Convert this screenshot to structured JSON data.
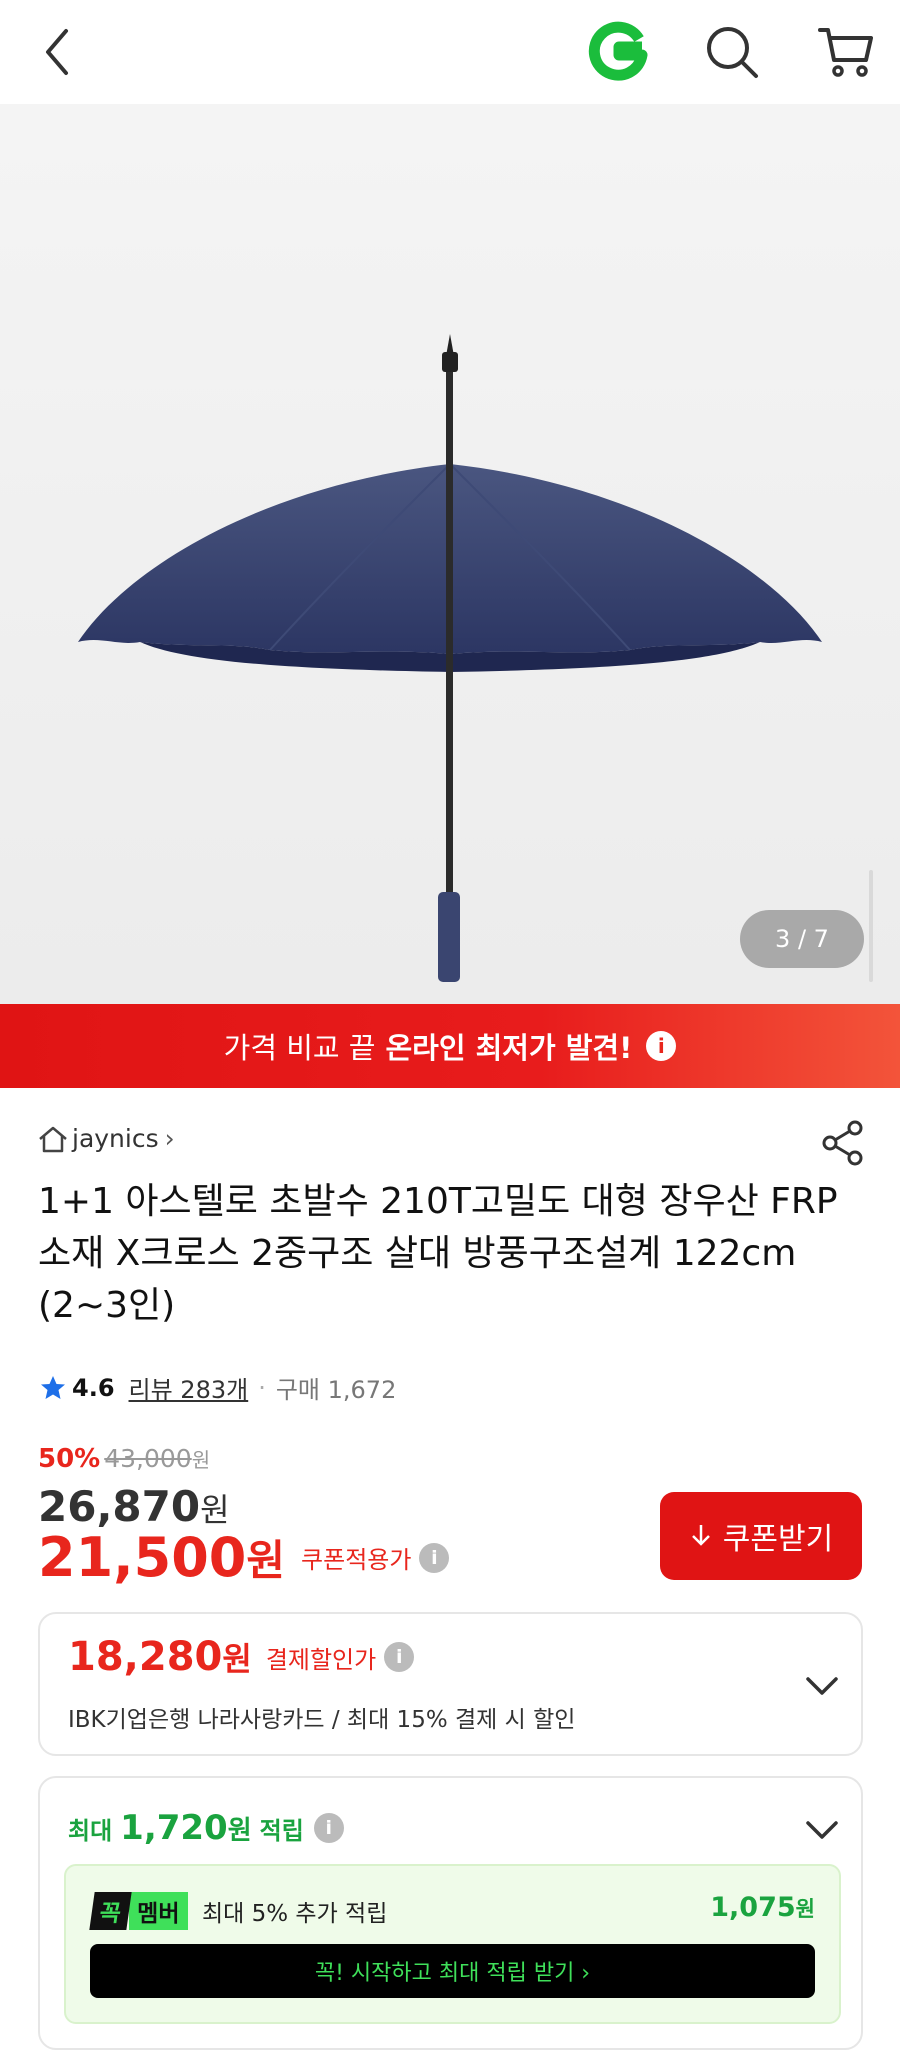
{
  "header": {
    "logo_letter": "G",
    "brand_color": "#1bbd3c"
  },
  "gallery": {
    "counter": "3 / 7",
    "image_alt": "navy umbrella"
  },
  "banner": {
    "text": "가격 비교 끝",
    "strong_text": "온라인 최저가 발견!",
    "info": "i"
  },
  "seller": {
    "name": "jaynics",
    "chevron": "›"
  },
  "product": {
    "title": "1+1 아스텔로 초발수 210T고밀도 대형 장우산 FRP소재 X크로스 2중구조 살대 방풍구조설계 122cm (2~3인)",
    "rating": "4.6",
    "review": "리뷰 283개",
    "separator": "·",
    "purchases": "구매 1,672"
  },
  "price": {
    "discount_rate": "50%",
    "original": "43,000",
    "original_unit": "원",
    "sale": "26,870",
    "sale_unit": "원",
    "coupon_price": "21,500",
    "coupon_unit": "원",
    "coupon_label": "쿠폰적용가",
    "coupon_button": "쿠폰받기"
  },
  "card_discount": {
    "price": "18,280",
    "unit": "원",
    "label": "결제할인가",
    "description": "IBK기업은행 나라사랑카드 / 최대 15% 결제 시 할인"
  },
  "points": {
    "prefix": "최대",
    "amount": "1,720",
    "unit": "원",
    "suffix": "적립",
    "member_badge_left": "꼭",
    "member_badge_right": "멤버",
    "member_text": "최대 5% 추가 적립",
    "member_amount": "1,075",
    "member_unit": "원",
    "cta": "꼭! 시작하고 최대 적립 받기 ›"
  },
  "colors": {
    "accent_red": "#e8261d",
    "point_green": "#1aa33f"
  }
}
